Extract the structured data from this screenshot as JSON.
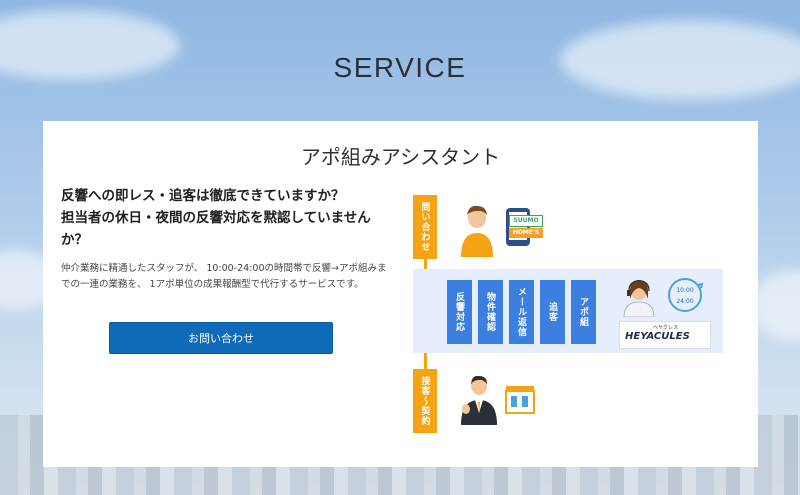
{
  "section_title": "SERVICE",
  "card": {
    "title": "アポ組みアシスタント",
    "headline_line1": "反響への即レス・追客は徹底できていますか？",
    "headline_line2": "担当者の休日・夜間の反響対応を黙認していませんか？",
    "description": "仲介業務に精通したスタッフが、 10:00-24:00の時間帯で反響→アポ組みまでの一連の業務を、 1アポ単位の成果報酬型で代行するサービスです。",
    "cta_label": "お問い合わせ"
  },
  "diagram": {
    "label_inquiry": "問い合わせ",
    "label_service": "接客〜契約",
    "steps": [
      "反響対応",
      "物件確認",
      "メール返信",
      "追客",
      "アポ組"
    ],
    "portal_1": "SUUMO",
    "portal_2": "HOME'S",
    "brand_name": "HEYACULES",
    "brand_kana": "ヘヤクレス",
    "hours_start": "10:00",
    "hours_end": "24:00",
    "colors": {
      "accent_orange": "#f5a313",
      "step_blue": "#3d7fe0",
      "panel_bg": "#e6eefb",
      "cta_blue": "#0f6bb8"
    }
  }
}
